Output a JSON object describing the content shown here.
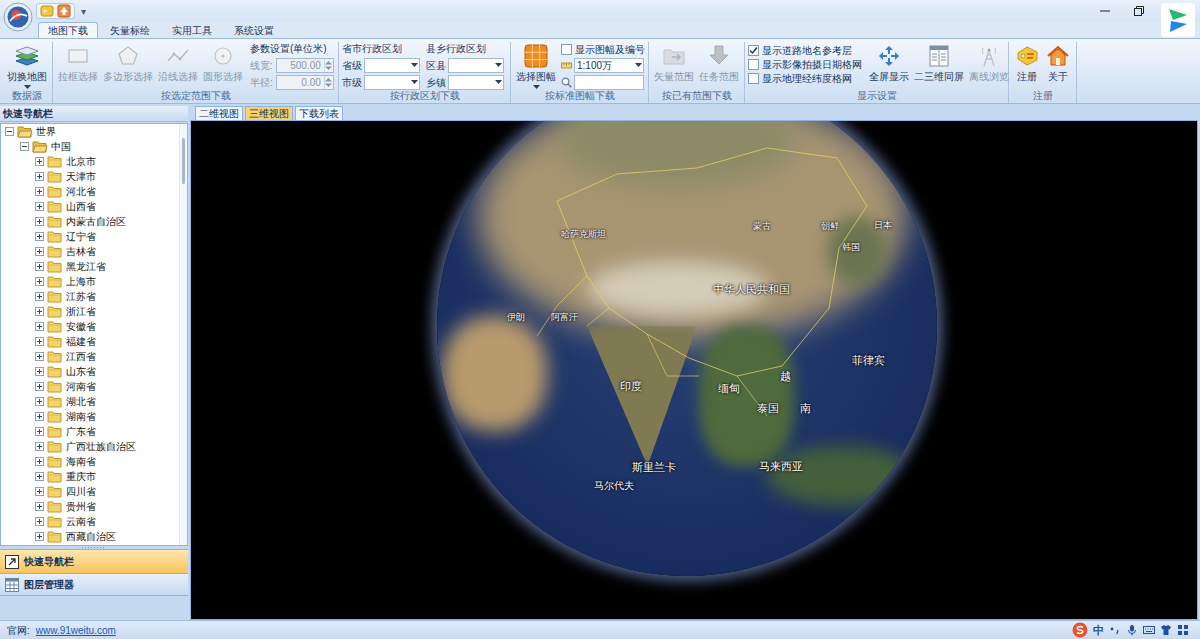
{
  "title_bar": {
    "menu_arrow": "▾"
  },
  "ribbon_tabs": [
    {
      "label": "地图下载",
      "selected": true
    },
    {
      "label": "矢量标绘",
      "selected": false
    },
    {
      "label": "实用工具",
      "selected": false
    },
    {
      "label": "系统设置",
      "selected": false
    }
  ],
  "ribbon": {
    "data_source": {
      "label": "数据源",
      "button": {
        "label": "切换地图",
        "disabled": false
      }
    },
    "range": {
      "label": "按选定范围下载",
      "buttons": [
        {
          "label": "拉框选择",
          "disabled": true
        },
        {
          "label": "多边形选择",
          "disabled": true
        },
        {
          "label": "沿线选择",
          "disabled": true
        },
        {
          "label": "圆形选择",
          "disabled": true
        }
      ],
      "params_title": "参数设置(单位米)",
      "fields": [
        {
          "label": "线宽:",
          "value": "500.00",
          "disabled": true
        },
        {
          "label": "半径:",
          "value": "0.00",
          "disabled": true
        }
      ]
    },
    "admin": {
      "label": "按行政区划下载",
      "columns": [
        {
          "title": "省市行政区划",
          "fields": [
            "省级",
            "市级"
          ]
        },
        {
          "title": "县乡行政区划",
          "fields": [
            "区县",
            "乡镇"
          ]
        }
      ]
    },
    "sheet": {
      "label": "按标准图幅下载",
      "button": {
        "label": "选择图幅",
        "disabled": false
      },
      "checkbox": {
        "label": "显示图幅及编号",
        "checked": false
      },
      "scale": "1:100万"
    },
    "existing": {
      "label": "按已有范围下载",
      "buttons": [
        {
          "label": "矢量范围",
          "disabled": true
        },
        {
          "label": "任务范围",
          "disabled": true
        }
      ]
    },
    "display": {
      "label": "显示设置",
      "checkboxes": [
        {
          "label": "显示道路地名参考层",
          "checked": true
        },
        {
          "label": "显示影像拍摄日期格网",
          "checked": false
        },
        {
          "label": "显示地理经纬度格网",
          "checked": false
        }
      ],
      "buttons": [
        {
          "label": "全屏显示",
          "disabled": false
        },
        {
          "label": "二三维同屏",
          "disabled": false
        },
        {
          "label": "离线浏览",
          "disabled": true
        }
      ]
    },
    "register": {
      "label": "注册",
      "buttons": [
        {
          "label": "注册",
          "disabled": false
        },
        {
          "label": "关于",
          "disabled": false
        }
      ]
    }
  },
  "nav_panel": {
    "title": "快速导航栏",
    "tree": {
      "label": "世界",
      "expanded": true,
      "children": [
        {
          "label": "中国",
          "expanded": true,
          "children": [
            {
              "label": "北京市",
              "expanded": false
            },
            {
              "label": "天津市",
              "expanded": false
            },
            {
              "label": "河北省",
              "expanded": false
            },
            {
              "label": "山西省",
              "expanded": false
            },
            {
              "label": "内蒙古自治区",
              "expanded": false
            },
            {
              "label": "辽宁省",
              "expanded": false
            },
            {
              "label": "吉林省",
              "expanded": false
            },
            {
              "label": "黑龙江省",
              "expanded": false
            },
            {
              "label": "上海市",
              "expanded": false
            },
            {
              "label": "江苏省",
              "expanded": false
            },
            {
              "label": "浙江省",
              "expanded": false
            },
            {
              "label": "安徽省",
              "expanded": false
            },
            {
              "label": "福建省",
              "expanded": false
            },
            {
              "label": "江西省",
              "expanded": false
            },
            {
              "label": "山东省",
              "expanded": false
            },
            {
              "label": "河南省",
              "expanded": false
            },
            {
              "label": "湖北省",
              "expanded": false
            },
            {
              "label": "湖南省",
              "expanded": false
            },
            {
              "label": "广东省",
              "expanded": false
            },
            {
              "label": "广西壮族自治区",
              "expanded": false
            },
            {
              "label": "海南省",
              "expanded": false
            },
            {
              "label": "重庆市",
              "expanded": false
            },
            {
              "label": "四川省",
              "expanded": false
            },
            {
              "label": "贵州省",
              "expanded": false
            },
            {
              "label": "云南省",
              "expanded": false
            },
            {
              "label": "西藏自治区",
              "expanded": false
            }
          ]
        }
      ]
    },
    "tree_scrollbar": {
      "level": 0.11
    },
    "bottom_tabs": [
      {
        "label": "快速导航栏",
        "selected": true
      },
      {
        "label": "图层管理器",
        "selected": false
      }
    ]
  },
  "view_tabs": [
    {
      "label": "二维视图",
      "selected": false
    },
    {
      "label": "三维视图",
      "selected": true
    },
    {
      "label": "下载列表",
      "selected": false
    }
  ],
  "map_labels": [
    "中华人民共和国",
    "印度",
    "缅甸",
    "泰国",
    "越",
    "南",
    "菲律宾",
    "马来西亚",
    "斯里兰卡",
    "马尔代夫",
    "日本",
    "韩国",
    "朝鲜",
    "蒙古",
    "阿富汗",
    "伊朗",
    "哈萨克斯坦"
  ],
  "status_bar": {
    "site_label": "官网:",
    "site_url": "www.91weitu.com",
    "ime_mode": "中"
  }
}
